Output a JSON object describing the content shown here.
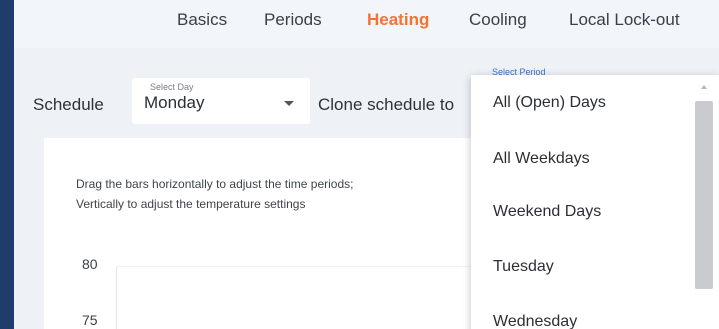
{
  "tabs": [
    {
      "label": "Basics",
      "active": false
    },
    {
      "label": "Periods",
      "active": false
    },
    {
      "label": "Heating",
      "active": true
    },
    {
      "label": "Cooling",
      "active": false
    },
    {
      "label": "Local Lock-out",
      "active": false
    }
  ],
  "schedule": {
    "label": "Schedule",
    "day_select": {
      "caption": "Select Day",
      "value": "Monday"
    },
    "clone_label": "Clone schedule to",
    "period_caption": "Select Period"
  },
  "panel": {
    "help_line1": "Drag the bars horizontally to adjust the time periods;",
    "help_line2": "Vertically to adjust the temperature settings",
    "y_ticks": [
      "80",
      "75"
    ]
  },
  "dropdown": {
    "options": [
      "All (Open) Days",
      "All Weekdays",
      "Weekend Days",
      "Tuesday",
      "Wednesday"
    ]
  },
  "colors": {
    "background": "#1f3d6b",
    "frame": "#eef2f7",
    "active_tab": "#f37335",
    "caption_blue": "#3b73c8"
  }
}
